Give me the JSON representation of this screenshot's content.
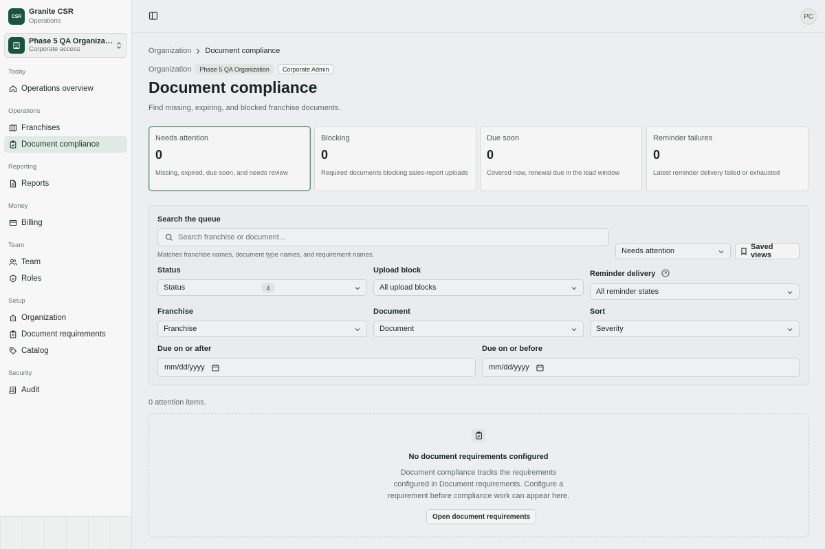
{
  "brand": {
    "logo": "CSR",
    "name": "Granite CSR",
    "subtitle": "Operations"
  },
  "org_switcher": {
    "name": "Phase 5 QA Organizat...",
    "subtitle": "Corporate access",
    "icon": "building-icon"
  },
  "nav": {
    "today": {
      "label": "Today",
      "items": [
        {
          "label": "Operations overview",
          "icon": "home-icon"
        }
      ]
    },
    "operations": {
      "label": "Operations",
      "items": [
        {
          "label": "Franchises",
          "icon": "map-icon"
        },
        {
          "label": "Document compliance",
          "icon": "clipboard-check-icon",
          "active": true
        }
      ]
    },
    "reporting": {
      "label": "Reporting",
      "items": [
        {
          "label": "Reports",
          "icon": "file-text-icon"
        }
      ]
    },
    "money": {
      "label": "Money",
      "items": [
        {
          "label": "Billing",
          "icon": "credit-card-icon"
        }
      ]
    },
    "team": {
      "label": "Team",
      "items": [
        {
          "label": "Team",
          "icon": "users-icon"
        },
        {
          "label": "Roles",
          "icon": "shield-icon"
        }
      ]
    },
    "setup": {
      "label": "Setup",
      "items": [
        {
          "label": "Organization",
          "icon": "building-icon"
        },
        {
          "label": "Document requirements",
          "icon": "clipboard-icon"
        },
        {
          "label": "Catalog",
          "icon": "tag-icon"
        }
      ]
    },
    "security": {
      "label": "Security",
      "items": [
        {
          "label": "Audit",
          "icon": "scroll-icon"
        }
      ]
    }
  },
  "topbar": {
    "avatar": "PC"
  },
  "breadcrumb": {
    "parent": "Organization",
    "current": "Document compliance"
  },
  "meta": {
    "label": "Organization",
    "org_chip": "Phase 5 QA Organization",
    "role_chip": "Corporate Admin"
  },
  "page": {
    "title": "Document compliance",
    "subtitle": "Find missing, expiring, and blocked franchise documents."
  },
  "cards": [
    {
      "title": "Needs attention",
      "value": "0",
      "desc": "Missing, expired, due soon, and needs review"
    },
    {
      "title": "Blocking",
      "value": "0",
      "desc": "Required documents blocking sales-report uploads"
    },
    {
      "title": "Due soon",
      "value": "0",
      "desc": "Covered now, renewal due in the lead window"
    },
    {
      "title": "Reminder failures",
      "value": "0",
      "desc": "Latest reminder delivery failed or exhausted"
    }
  ],
  "filters": {
    "search_label": "Search the queue",
    "search_placeholder": "Search franchise or document...",
    "search_hint": "Matches franchise names, document type names, and requirement names.",
    "queue_select": "Needs attention",
    "saved_views": "Saved views",
    "status_label": "Status",
    "status_value": "Status",
    "status_count": "4",
    "upload_label": "Upload block",
    "upload_value": "All upload blocks",
    "reminder_label": "Reminder delivery",
    "reminder_value": "All reminder states",
    "franchise_label": "Franchise",
    "franchise_value": "Franchise",
    "document_label": "Document",
    "document_value": "Document",
    "sort_label": "Sort",
    "sort_value": "Severity",
    "due_after_label": "Due on or after",
    "due_after_value": "mm/dd/yyyy",
    "due_before_label": "Due on or before",
    "due_before_value": "mm/dd/yyyy"
  },
  "results": {
    "count": "0 attention items."
  },
  "empty": {
    "title": "No document requirements configured",
    "desc": "Document compliance tracks the requirements configured in Document requirements. Configure a requirement before compliance work can appear here.",
    "button": "Open document requirements"
  }
}
